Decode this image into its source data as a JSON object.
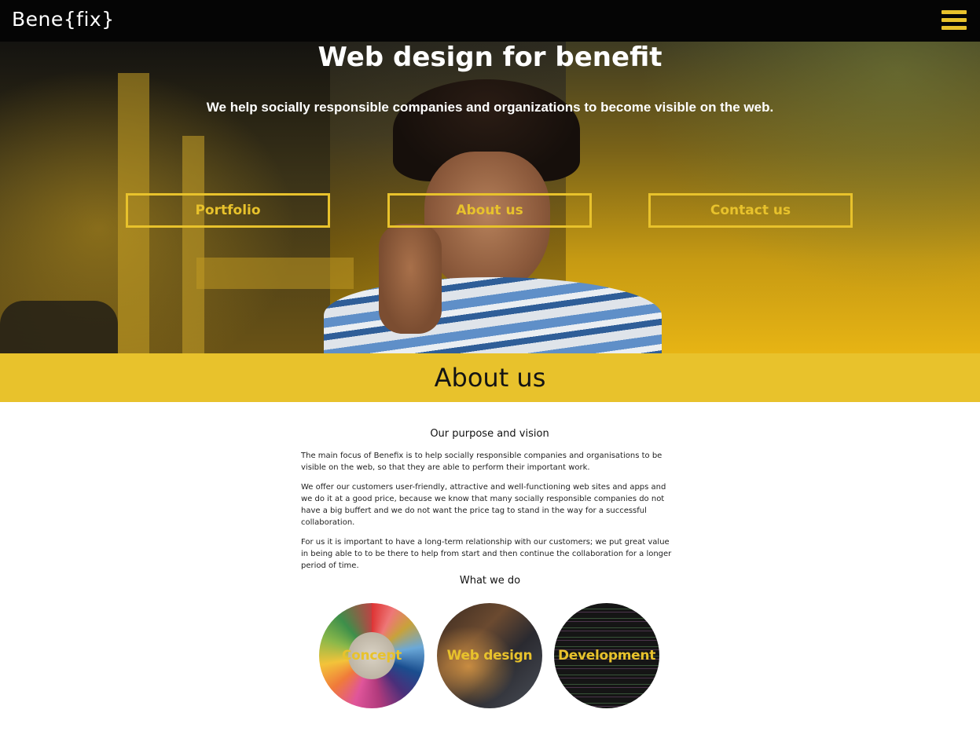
{
  "header": {
    "logo": "Bene{fix}",
    "menu_icon": "hamburger-menu-icon"
  },
  "hero": {
    "title": "Web design for benefit",
    "subtitle": "We help socially responsible companies and organizations to become visible on the web.",
    "buttons": [
      {
        "label": "Portfolio"
      },
      {
        "label": "About us"
      },
      {
        "label": "Contact us"
      }
    ]
  },
  "about": {
    "heading": "About us",
    "purpose_title": "Our purpose and vision",
    "paragraphs": [
      "The main focus of Benefix is to help socially responsible companies and organisations to be visible on the web, so that they are able to perform their important work.",
      "We offer our customers user-friendly, attractive and well-functioning web sites and apps and we do it at a good price, because we know that many socially responsible companies do not have a big buffert and we do not want the price tag to stand in the way for a successful collaboration.",
      "For us it is important to have a long-term relationship with our customers; we put great value in being able to to be there to help from start and then continue the collaboration for a longer period of time."
    ],
    "what_title": "What we do",
    "services": [
      {
        "label": "Concept"
      },
      {
        "label": "Web design"
      },
      {
        "label": "Development"
      }
    ]
  },
  "colors": {
    "accent": "#e8c22c",
    "topbar": "#050505"
  }
}
